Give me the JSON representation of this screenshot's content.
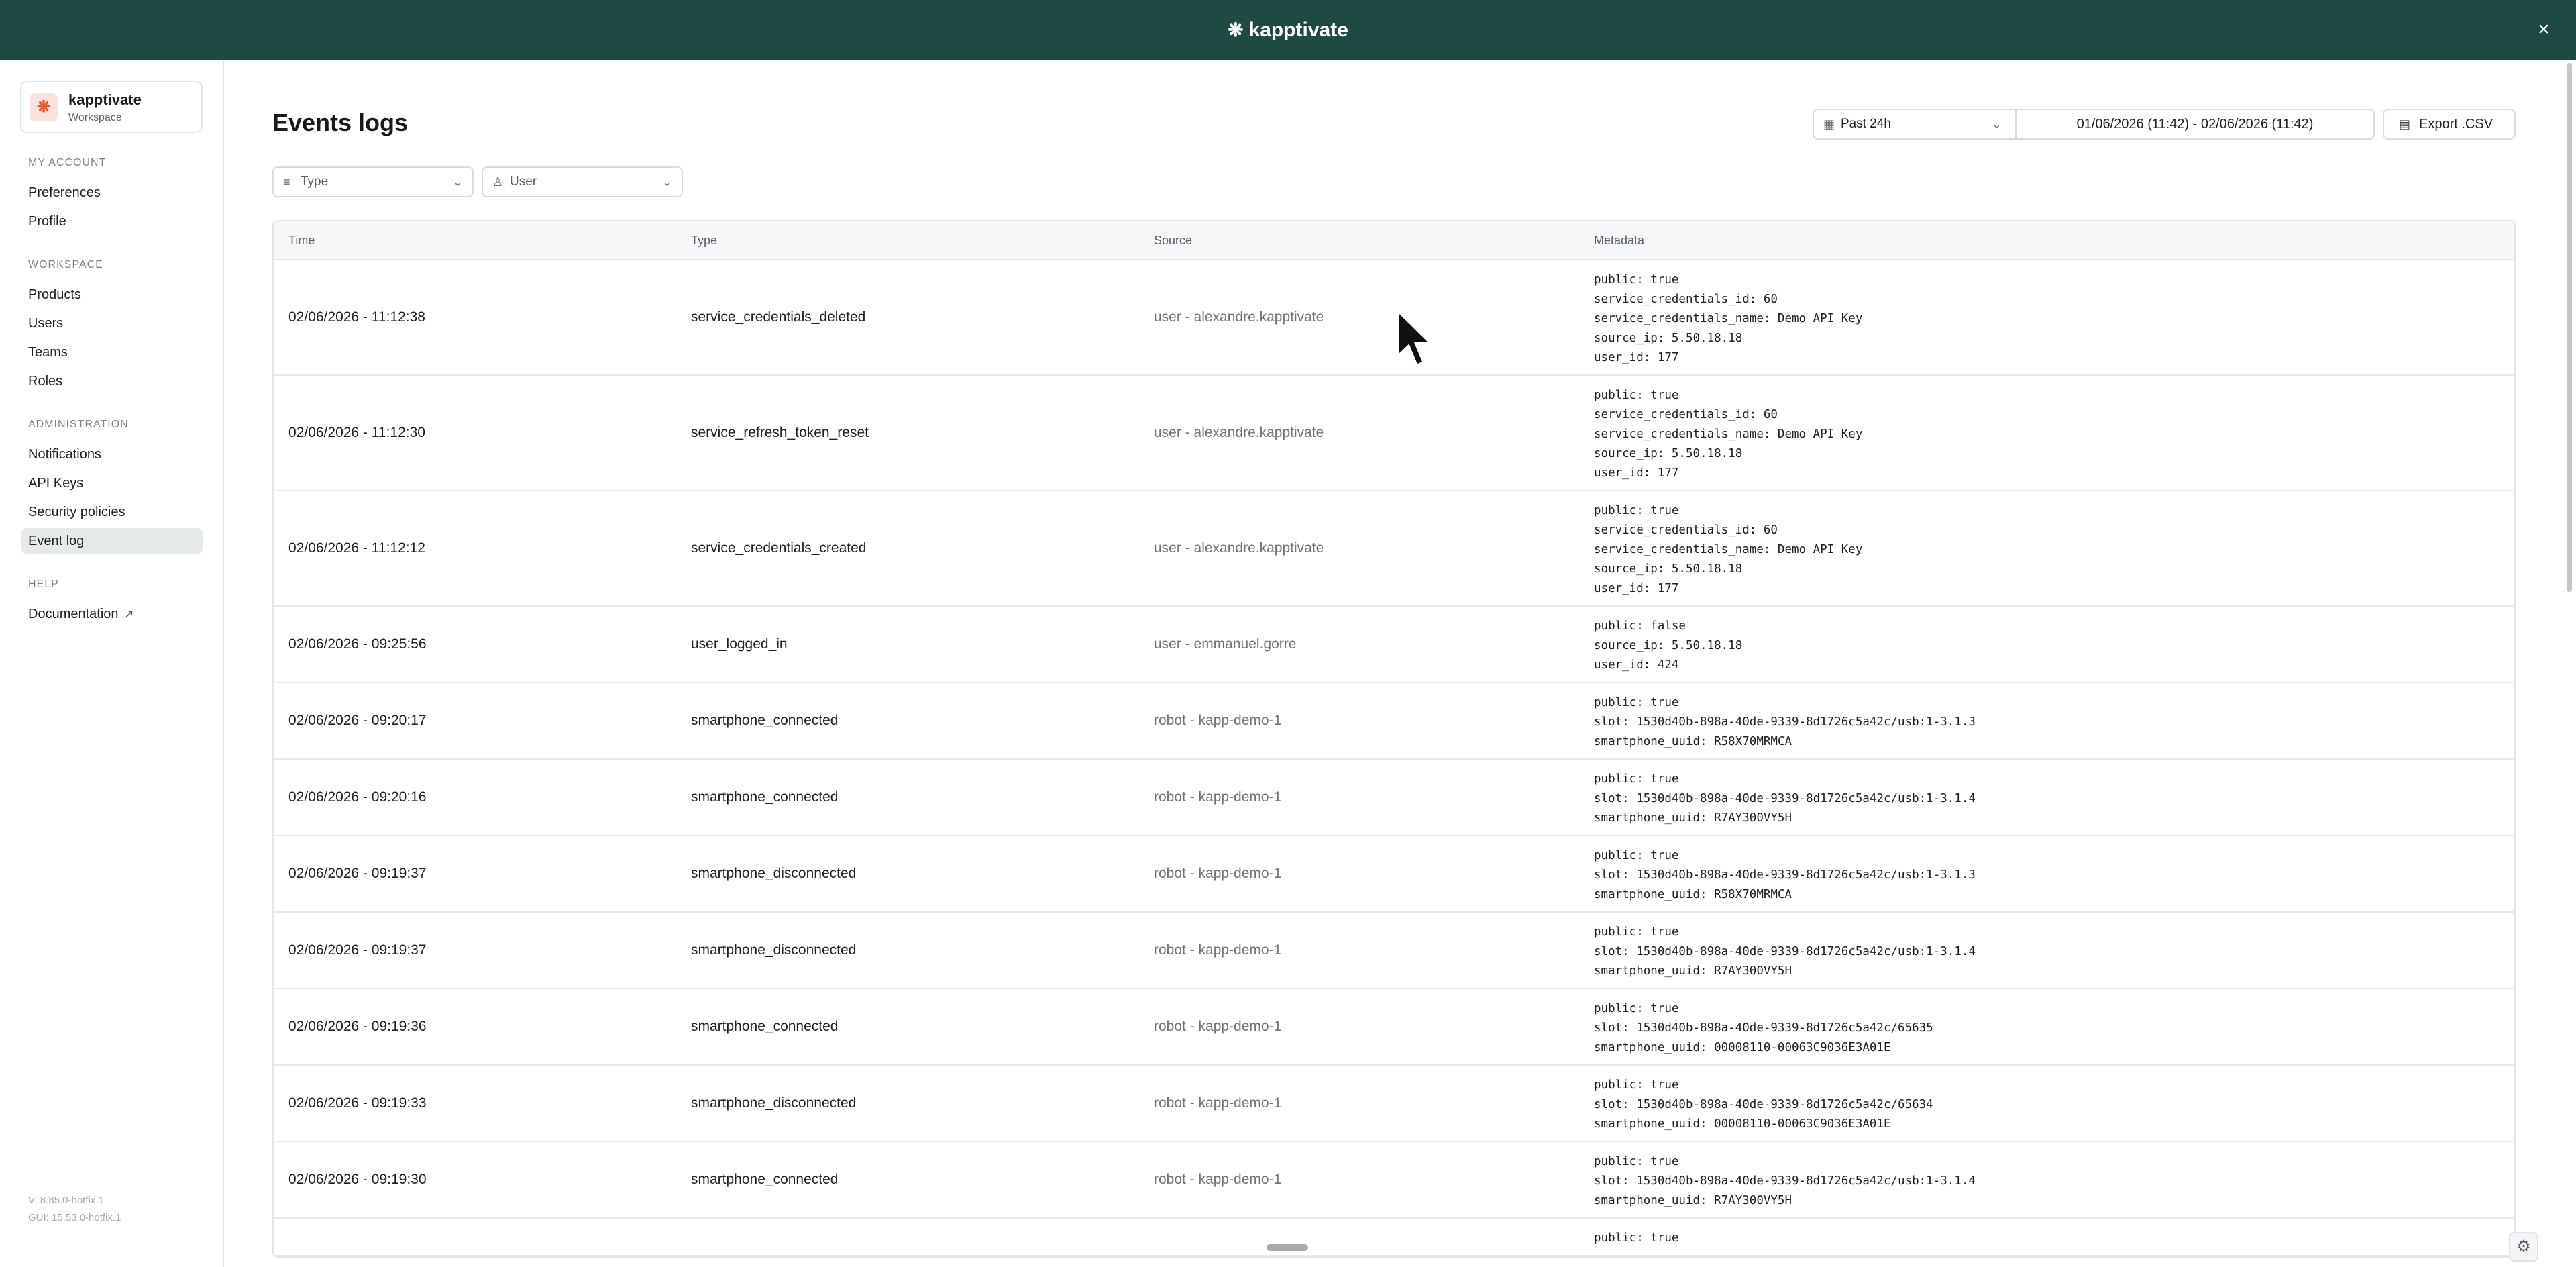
{
  "app": {
    "brand": "kapptivate"
  },
  "workspace": {
    "name": "kapptivate",
    "label": "Workspace"
  },
  "sidebar": {
    "sections": [
      {
        "title": "MY ACCOUNT",
        "items": [
          "Preferences",
          "Profile"
        ]
      },
      {
        "title": "WORKSPACE",
        "items": [
          "Products",
          "Users",
          "Teams",
          "Roles"
        ]
      },
      {
        "title": "ADMINISTRATION",
        "items": [
          "Notifications",
          "API Keys",
          "Security policies",
          "Event log"
        ]
      },
      {
        "title": "HELP",
        "items": [
          "Documentation"
        ]
      }
    ],
    "active_item": "Event log",
    "version": "V: 8.85.0-hotfix.1",
    "gui_version": "GUI: 15.53.0-hotfix.1"
  },
  "page": {
    "title": "Events logs"
  },
  "filters": {
    "type_placeholder": "Type",
    "user_placeholder": "User"
  },
  "range": {
    "preset": "Past 24h",
    "dates": "01/06/2026 (11:42) - 02/06/2026 (11:42)"
  },
  "export": {
    "label": "Export .CSV"
  },
  "table": {
    "columns": [
      "Time",
      "Type",
      "Source",
      "Metadata"
    ],
    "rows": [
      {
        "time": "02/06/2026 - 11:12:38",
        "type": "service_credentials_deleted",
        "source": "user - alexandre.kapptivate",
        "metadata": [
          "public: true",
          "service_credentials_id: 60",
          "service_credentials_name: Demo API Key",
          "source_ip: 5.50.18.18",
          "user_id: 177"
        ]
      },
      {
        "time": "02/06/2026 - 11:12:30",
        "type": "service_refresh_token_reset",
        "source": "user - alexandre.kapptivate",
        "metadata": [
          "public: true",
          "service_credentials_id: 60",
          "service_credentials_name: Demo API Key",
          "source_ip: 5.50.18.18",
          "user_id: 177"
        ]
      },
      {
        "time": "02/06/2026 - 11:12:12",
        "type": "service_credentials_created",
        "source": "user - alexandre.kapptivate",
        "metadata": [
          "public: true",
          "service_credentials_id: 60",
          "service_credentials_name: Demo API Key",
          "source_ip: 5.50.18.18",
          "user_id: 177"
        ]
      },
      {
        "time": "02/06/2026 - 09:25:56",
        "type": "user_logged_in",
        "source": "user - emmanuel.gorre",
        "metadata": [
          "public: false",
          "source_ip: 5.50.18.18",
          "user_id: 424"
        ]
      },
      {
        "time": "02/06/2026 - 09:20:17",
        "type": "smartphone_connected",
        "source": "robot - kapp-demo-1",
        "metadata": [
          "public: true",
          "slot: 1530d40b-898a-40de-9339-8d1726c5a42c/usb:1-3.1.3",
          "smartphone_uuid: R58X70MRMCA"
        ]
      },
      {
        "time": "02/06/2026 - 09:20:16",
        "type": "smartphone_connected",
        "source": "robot - kapp-demo-1",
        "metadata": [
          "public: true",
          "slot: 1530d40b-898a-40de-9339-8d1726c5a42c/usb:1-3.1.4",
          "smartphone_uuid: R7AY300VY5H"
        ]
      },
      {
        "time": "02/06/2026 - 09:19:37",
        "type": "smartphone_disconnected",
        "source": "robot - kapp-demo-1",
        "metadata": [
          "public: true",
          "slot: 1530d40b-898a-40de-9339-8d1726c5a42c/usb:1-3.1.3",
          "smartphone_uuid: R58X70MRMCA"
        ]
      },
      {
        "time": "02/06/2026 - 09:19:37",
        "type": "smartphone_disconnected",
        "source": "robot - kapp-demo-1",
        "metadata": [
          "public: true",
          "slot: 1530d40b-898a-40de-9339-8d1726c5a42c/usb:1-3.1.4",
          "smartphone_uuid: R7AY300VY5H"
        ]
      },
      {
        "time": "02/06/2026 - 09:19:36",
        "type": "smartphone_connected",
        "source": "robot - kapp-demo-1",
        "metadata": [
          "public: true",
          "slot: 1530d40b-898a-40de-9339-8d1726c5a42c/65635",
          "smartphone_uuid: 00008110-00063C9036E3A01E"
        ]
      },
      {
        "time": "02/06/2026 - 09:19:33",
        "type": "smartphone_disconnected",
        "source": "robot - kapp-demo-1",
        "metadata": [
          "public: true",
          "slot: 1530d40b-898a-40de-9339-8d1726c5a42c/65634",
          "smartphone_uuid: 00008110-00063C9036E3A01E"
        ]
      },
      {
        "time": "02/06/2026 - 09:19:30",
        "type": "smartphone_connected",
        "source": "robot - kapp-demo-1",
        "metadata": [
          "public: true",
          "slot: 1530d40b-898a-40de-9339-8d1726c5a42c/usb:1-3.1.4",
          "smartphone_uuid: R7AY300VY5H"
        ]
      },
      {
        "time": "",
        "type": "",
        "source": "",
        "metadata": [
          "public: true"
        ]
      }
    ]
  },
  "icons": {
    "close": "close-icon",
    "filter": "filter-icon",
    "user": "user-icon",
    "calendar": "calendar-icon",
    "chevron": "chevron-down-icon",
    "file": "file-icon",
    "external": "external-link-icon",
    "settings": "gear-icon"
  },
  "colors": {
    "topbar": "#1f4a43",
    "active_nav": "#e5e9e8",
    "brand_accent": "#e85b2f"
  }
}
